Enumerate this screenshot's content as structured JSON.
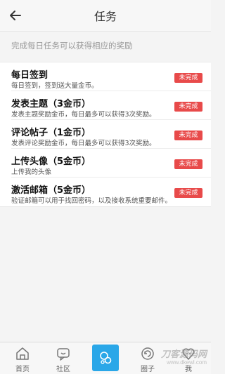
{
  "header": {
    "title": "任务"
  },
  "notice": "完成每日任务可以获得相应的奖励",
  "tasks": [
    {
      "title": "每日签到",
      "desc": "每日签到，签到送大量金币。",
      "status": "未完成"
    },
    {
      "title": "发表主题（3金币）",
      "desc": "发表主题奖励金币，每日最多可以获得3次奖励。",
      "status": "未完成"
    },
    {
      "title": "评论帖子（1金币）",
      "desc": "发表评论奖励金币，每日最多可以获得3次奖励。",
      "status": "未完成"
    },
    {
      "title": "上传头像（5金币）",
      "desc": "上传我的头像",
      "status": "未完成"
    },
    {
      "title": "激活邮箱（5金币）",
      "desc": "验证邮箱可以用于找回密码，以及接收系统重要邮件。",
      "status": "未完成"
    }
  ],
  "tabbar": {
    "home": "首页",
    "community": "社区",
    "circle": "圈子",
    "fifth": "我"
  },
  "watermark": {
    "text": "刀客源码网",
    "url": "www.dkewl.com"
  },
  "colors": {
    "badge": "#e84a4a",
    "center_button": "#2aa7e8"
  }
}
